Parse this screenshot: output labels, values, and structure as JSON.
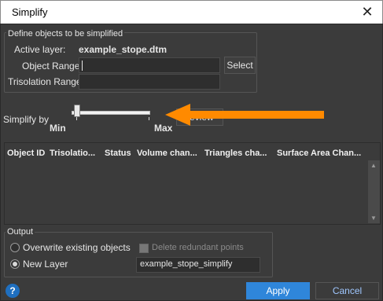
{
  "window": {
    "title": "Simplify",
    "close_symbol": "✕"
  },
  "define_group": {
    "legend": "Define objects to be simplified",
    "active_layer_label": "Active layer:",
    "active_layer_value": "example_stope.dtm",
    "object_range_label": "Object Range",
    "object_range_value": "",
    "trisolation_range_label": "Trisolation Range",
    "trisolation_range_value": "",
    "select_button": "Select"
  },
  "simplify": {
    "label": "Simplify by",
    "min_label": "Min",
    "max_label": "Max",
    "preview_button": "Preview",
    "slider_value_fraction": 0.0
  },
  "table": {
    "columns": [
      "Object ID",
      "Trisolatio...",
      "Status",
      "Volume chan...",
      "Triangles cha...",
      "Surface Area Chan..."
    ],
    "rows": []
  },
  "output": {
    "legend": "Output",
    "overwrite_label": "Overwrite existing objects",
    "new_layer_label": "New Layer",
    "delete_redundant_label": "Delete redundant points",
    "new_layer_name": "example_stope_simplify",
    "selected": "new_layer"
  },
  "footer": {
    "help_symbol": "?",
    "apply_label": "Apply",
    "cancel_label": "Cancel"
  },
  "colors": {
    "background": "#3b3b3b",
    "accent": "#2f86da",
    "annotation_arrow": "#ff8a00"
  }
}
